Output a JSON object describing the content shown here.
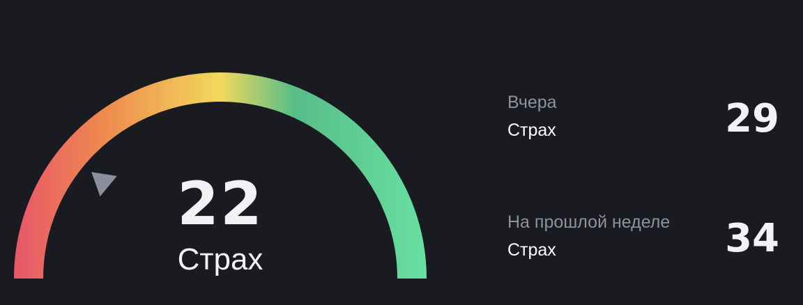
{
  "gauge": {
    "value": 22,
    "max": 100,
    "label": "Страх",
    "colors": [
      "#e8566a",
      "#ee8a4e",
      "#f2d85c",
      "#57bd88",
      "#68e0a0"
    ],
    "pointer_color": "#8a8f9b"
  },
  "history": [
    {
      "period": "Вчера",
      "label": "Страх",
      "value": "29"
    },
    {
      "period": "На прошлой неделе",
      "label": "Страх",
      "value": "34"
    }
  ]
}
